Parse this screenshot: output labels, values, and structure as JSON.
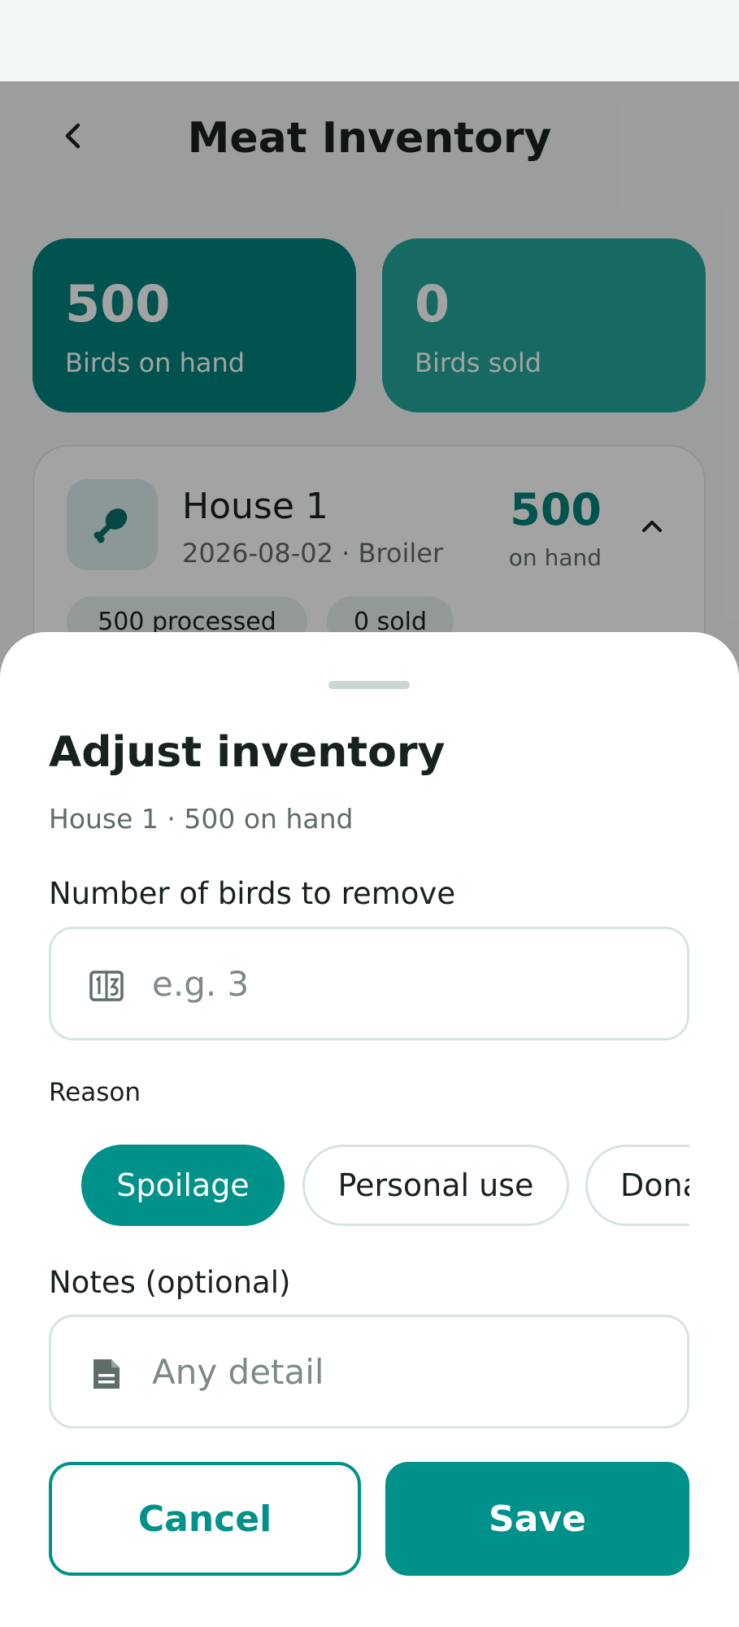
{
  "app": {
    "title": "Meat Inventory"
  },
  "stats": {
    "on_hand_value": "500",
    "on_hand_label": "Birds on hand",
    "sold_value": "0",
    "sold_label": "Birds sold"
  },
  "house": {
    "name": "House 1",
    "subtitle": "2026-08-02 · Broiler",
    "count": "500",
    "count_label": "on hand",
    "processed_chip": "500 processed",
    "sold_chip": "0 sold"
  },
  "sheet": {
    "title": "Adjust inventory",
    "subtitle": "House 1 · 500 on hand",
    "count_field": {
      "label": "Number of birds to remove",
      "placeholder": "e.g. 3",
      "value": ""
    },
    "reason_label": "Reason",
    "reasons": [
      {
        "label": "Spoilage",
        "selected": true
      },
      {
        "label": "Personal use",
        "selected": false
      },
      {
        "label": "Dona",
        "selected": false
      }
    ],
    "notes_field": {
      "label": "Notes (optional)",
      "placeholder": "Any detail",
      "value": ""
    },
    "cancel_label": "Cancel",
    "save_label": "Save"
  },
  "colors": {
    "primary": "#00918a",
    "primary_dark": "#00827a",
    "card_secondary": "#23a699",
    "text": "#17211f",
    "muted_text": "#5e6c6a"
  },
  "icons": {
    "back": "arrow-back-icon",
    "house": "drumstick-icon",
    "expand": "chevron-up-icon",
    "count_field": "numbers-icon",
    "notes_field": "notes-icon"
  }
}
